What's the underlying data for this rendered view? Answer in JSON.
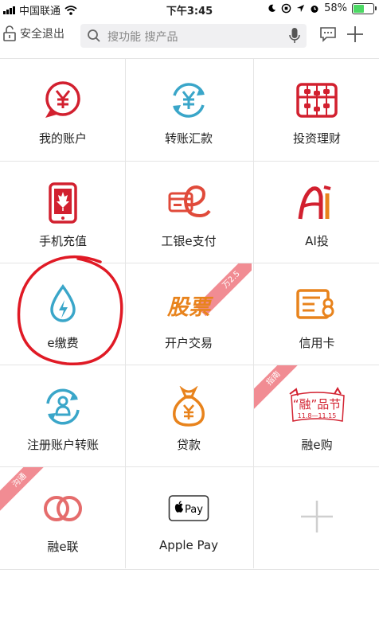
{
  "status_bar": {
    "carrier": "中国联通",
    "time": "下午3:45",
    "battery_percent": "58%",
    "battery_level": 0.58
  },
  "header": {
    "logout_label": "安全退出",
    "search_placeholder": "搜功能 搜产品"
  },
  "grid": {
    "items": [
      {
        "label": "我的账户",
        "icon": "yuan-circle-icon"
      },
      {
        "label": "转账汇款",
        "icon": "yuan-transfer-icon"
      },
      {
        "label": "投资理财",
        "icon": "abacus-icon"
      },
      {
        "label": "手机充值",
        "icon": "phone-maple-icon"
      },
      {
        "label": "工银e支付",
        "icon": "card-e-icon"
      },
      {
        "label": "AI投",
        "icon": "ai-logo-icon"
      },
      {
        "label": "e缴费",
        "icon": "water-drop-icon"
      },
      {
        "label": "开户交易",
        "icon": "stock-logo-icon",
        "logo_text": "股票"
      },
      {
        "label": "信用卡",
        "icon": "credit-card-icon"
      },
      {
        "label": "注册账户转账",
        "icon": "person-refresh-icon"
      },
      {
        "label": "贷款",
        "icon": "money-bag-icon"
      },
      {
        "label": "融e购",
        "icon": "festival-logo-icon",
        "logo_text": "“融”品节",
        "logo_dates": "11.8—11.15"
      },
      {
        "label": "融e联",
        "icon": "rings-icon"
      },
      {
        "label": "Apple Pay",
        "icon": "apple-pay-icon",
        "logo_text": "Pay"
      },
      {
        "label": "",
        "icon": "add-icon"
      }
    ],
    "ribbons": [
      "万2.5",
      "指南",
      "沟通"
    ]
  },
  "colors": {
    "brand_red": "#d2202f",
    "teal": "#3aa6c9",
    "orange": "#e8831c",
    "annotation_red": "#e01a25",
    "ribbon_pink": "#f18c93"
  }
}
